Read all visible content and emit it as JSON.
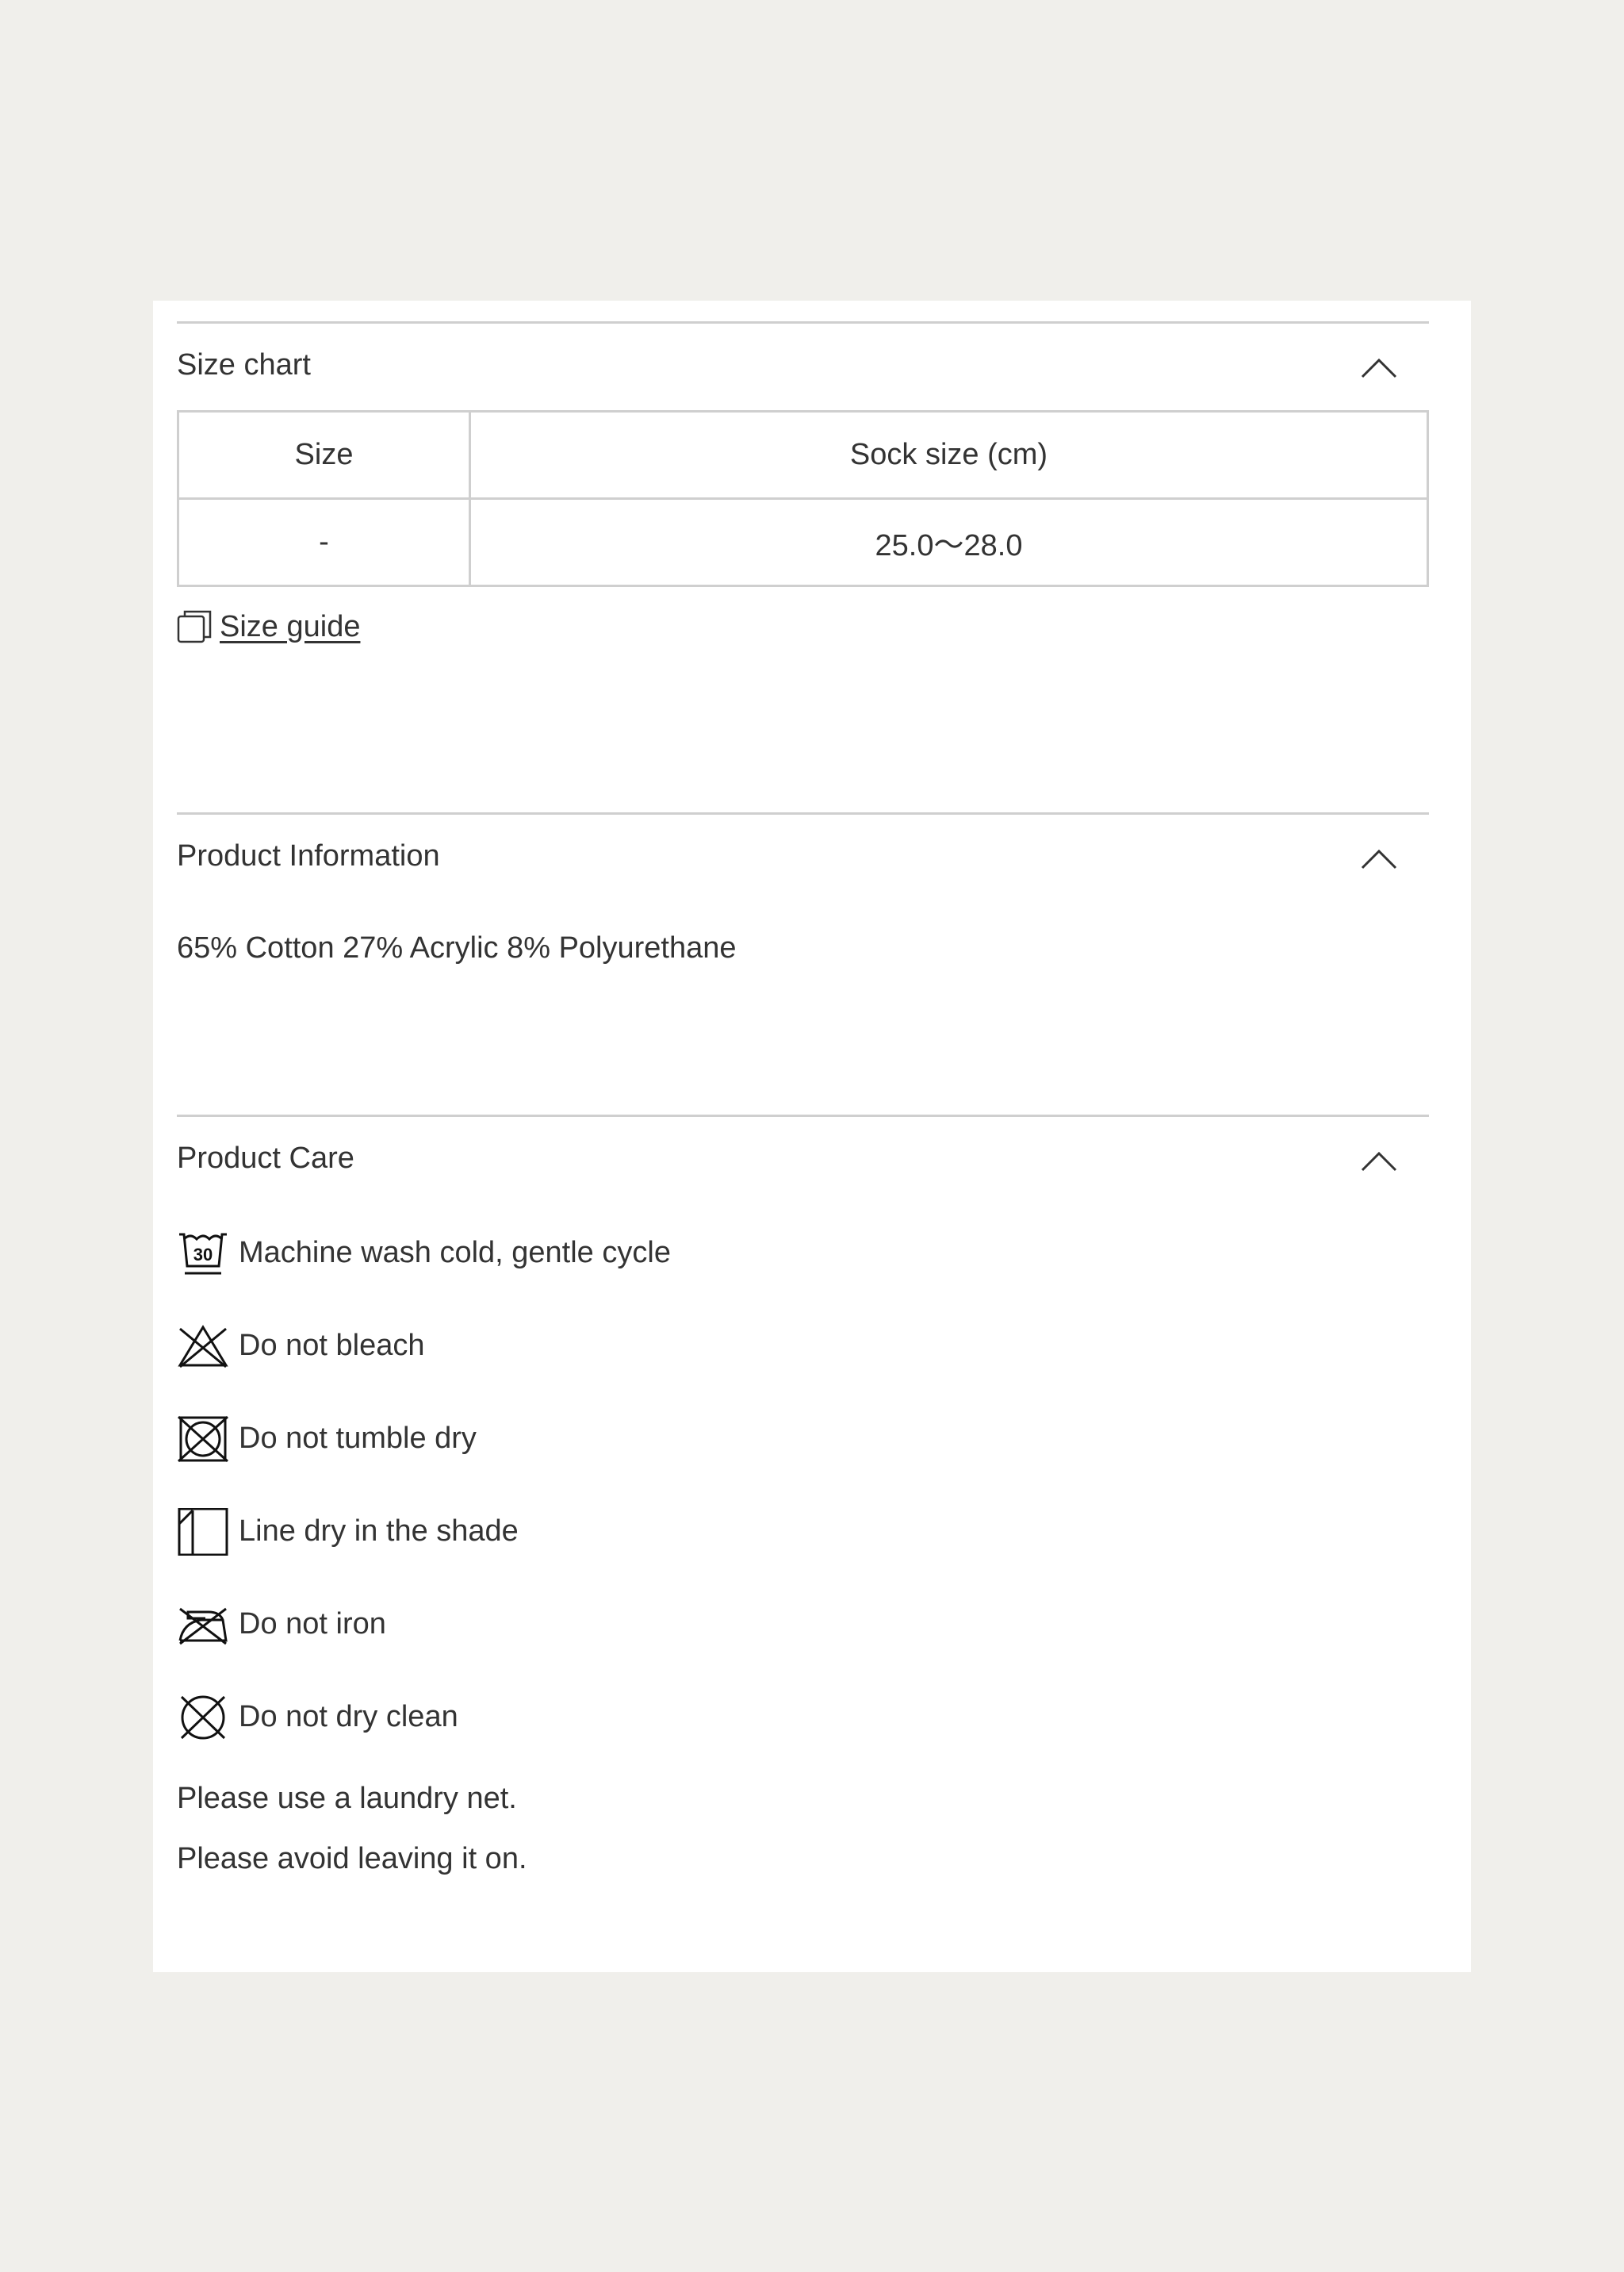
{
  "size_chart": {
    "title": "Size chart",
    "columns": [
      "Size",
      "Sock size (cm)"
    ],
    "rows": [
      [
        "-",
        "25.0〜28.0"
      ]
    ],
    "size_guide_label": "Size guide"
  },
  "product_info": {
    "title": "Product Information",
    "composition": "65% Cotton 27% Acrylic 8% Polyurethane"
  },
  "product_care": {
    "title": "Product Care",
    "wash_temp": "30",
    "items": [
      {
        "icon": "wash-30-icon",
        "label": "Machine wash cold, gentle cycle"
      },
      {
        "icon": "no-bleach-icon",
        "label": "Do not bleach"
      },
      {
        "icon": "no-tumble-dry-icon",
        "label": "Do not tumble dry"
      },
      {
        "icon": "line-dry-shade-icon",
        "label": "Line dry in the shade"
      },
      {
        "icon": "no-iron-icon",
        "label": "Do not iron"
      },
      {
        "icon": "no-dry-clean-icon",
        "label": "Do not dry clean"
      }
    ],
    "notes": [
      "Please use a laundry net.",
      "Please avoid leaving it on."
    ]
  }
}
